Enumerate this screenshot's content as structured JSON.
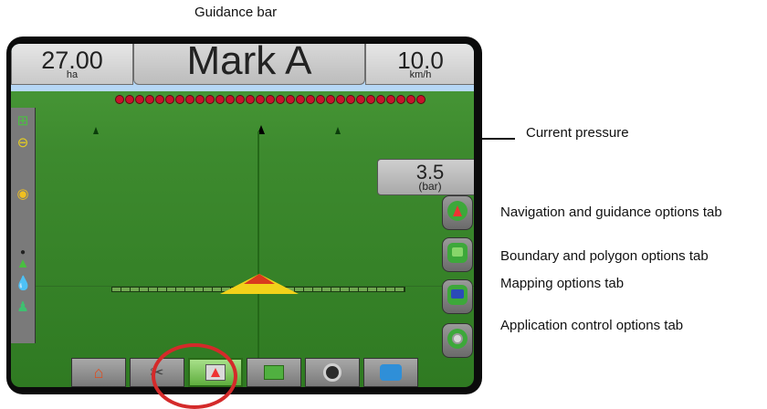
{
  "captions": {
    "guidance_bar": "Guidance bar",
    "current_pressure": "Current pressure",
    "navigation_tab": "Navigation and guidance options tab",
    "boundary_tab": "Boundary and polygon options tab",
    "mapping_tab": "Mapping options tab",
    "application_tab": "Application control options tab"
  },
  "guidance_bar": {
    "area_value": "27.00",
    "area_unit": "ha",
    "mark_label": "Mark A",
    "speed_value": "10.0",
    "speed_unit": "km/h"
  },
  "pressure": {
    "value": "3.5",
    "unit": "(bar)"
  },
  "lightbar_led_count": 31,
  "left_toolbar_icons": [
    "boom-section-icon",
    "minus-icon",
    "alert-icon",
    "tractor-small-icon",
    "water-drop-icon",
    "operator-icon"
  ],
  "side_tabs": [
    "navigation-guidance-icon",
    "boundary-polygon-icon",
    "mapping-icon",
    "application-control-icon"
  ],
  "bottom_tabs": [
    "home-icon",
    "tools-icon",
    "guidance-icon",
    "map-icon",
    "camera-icon",
    "vehicle-icon"
  ],
  "active_bottom_tab": "guidance-icon",
  "colors": {
    "highlight_ring": "#d42a2a",
    "led": "#c8142a",
    "field_green": "#3d8a2e",
    "tractor_yellow": "#f2d21a"
  }
}
